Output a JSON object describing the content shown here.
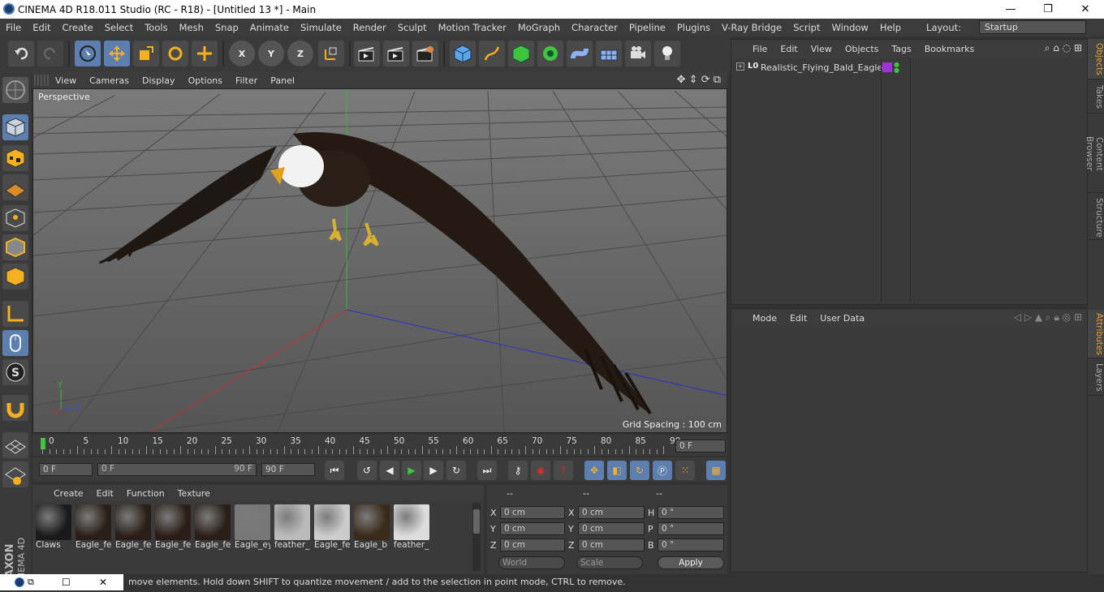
{
  "window": {
    "title": "CINEMA 4D R18.011 Studio (RC - R18) - [Untitled 13 *] - Main",
    "min_glyph": "—",
    "max_glyph": "❐",
    "close_glyph": "✕"
  },
  "menubar": {
    "items": [
      "File",
      "Edit",
      "Create",
      "Select",
      "Tools",
      "Mesh",
      "Snap",
      "Animate",
      "Simulate",
      "Render",
      "Sculpt",
      "Motion Tracker",
      "MoGraph",
      "Character",
      "Pipeline",
      "Plugins",
      "V-Ray Bridge",
      "Script",
      "Window",
      "Help"
    ],
    "layout_label": "Layout:",
    "layout_value": "Startup"
  },
  "toolbar": {
    "axis_x": "X",
    "axis_y": "Y",
    "axis_z": "Z"
  },
  "viewport": {
    "menu": [
      "View",
      "Cameras",
      "Display",
      "Options",
      "Filter",
      "Panel"
    ],
    "label": "Perspective",
    "grid_spacing": "Grid Spacing : 100 cm",
    "axis_y": "Y",
    "axis_z": "Z"
  },
  "timeline": {
    "ticks": [
      "0",
      "5",
      "10",
      "15",
      "20",
      "25",
      "30",
      "35",
      "40",
      "45",
      "50",
      "55",
      "60",
      "65",
      "70",
      "75",
      "80",
      "85",
      "90"
    ],
    "current_frame": "0 F"
  },
  "animbar": {
    "start": "0 F",
    "range_start": "0 F",
    "range_end": "90 F",
    "end": "90 F"
  },
  "materials": {
    "menu": [
      "Create",
      "Edit",
      "Function",
      "Texture"
    ],
    "items": [
      {
        "name": "Claws",
        "color": "#1a1a1a"
      },
      {
        "name": "Eagle_fe",
        "color": "#2a1f18"
      },
      {
        "name": "Eagle_fe",
        "color": "#2a1f18"
      },
      {
        "name": "Eagle_fe",
        "color": "#2a1f18"
      },
      {
        "name": "Eagle_fe",
        "color": "#2a1f18"
      },
      {
        "name": "Eagle_ey",
        "color": "#777777"
      },
      {
        "name": "feather_",
        "color": "#bbbbbb"
      },
      {
        "name": "Eagle_fe",
        "color": "#cccccc"
      },
      {
        "name": "Eagle_b",
        "color": "#3a2a1a"
      },
      {
        "name": "feather_",
        "color": "#dddddd"
      }
    ]
  },
  "coords": {
    "header": [
      "--",
      "--",
      "--"
    ],
    "pos_labels": [
      "X",
      "Y",
      "Z"
    ],
    "size_labels": [
      "X",
      "Y",
      "Z"
    ],
    "rot_labels": [
      "H",
      "P",
      "B"
    ],
    "pos_values": [
      "0 cm",
      "0 cm",
      "0 cm"
    ],
    "size_values": [
      "0 cm",
      "0 cm",
      "0 cm"
    ],
    "rot_values": [
      "0 °",
      "0 °",
      "0 °"
    ],
    "space": "World",
    "mode": "Scale",
    "apply": "Apply"
  },
  "objects": {
    "menu": [
      "File",
      "Edit",
      "View",
      "Objects",
      "Tags",
      "Bookmarks"
    ],
    "items": [
      {
        "name": "Realistic_Flying_Bald_Eagle",
        "layer_glyph": "L0"
      }
    ]
  },
  "attributes": {
    "menu": [
      "Mode",
      "Edit",
      "User Data"
    ]
  },
  "sidetabs": [
    "Objects",
    "Takes",
    "Content Browser",
    "Structure",
    "Attributes",
    "Layers"
  ],
  "status": {
    "text": "move elements. Hold down SHIFT to quantize movement / add to the selection in point mode, CTRL to remove."
  },
  "brand": {
    "maxon": "MAXON",
    "cinema": "CINEMA 4D"
  },
  "colors": {
    "accent": "#5c7fb0",
    "tab_active": "#f0a030",
    "play_green": "#3ec43e",
    "record_red": "#d83030"
  }
}
